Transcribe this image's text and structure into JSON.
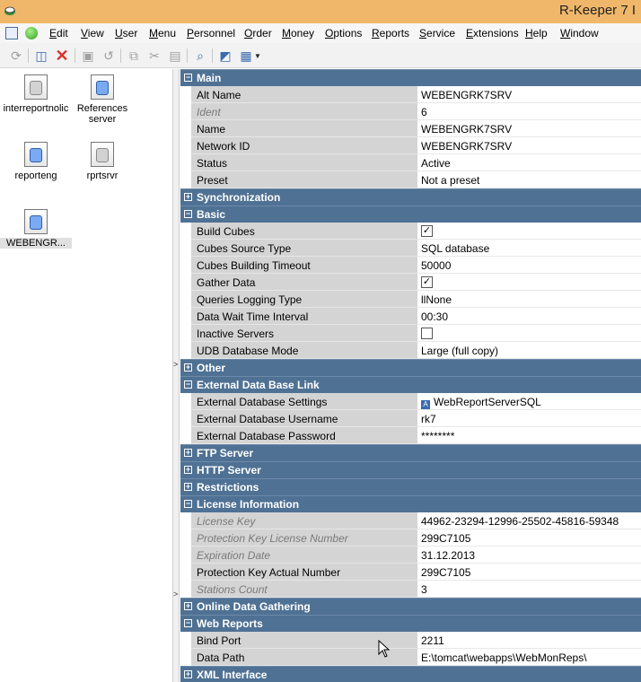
{
  "window": {
    "title": "R-Keeper 7 I"
  },
  "menu": [
    "Edit",
    "View",
    "User",
    "Menu",
    "Personnel",
    "Order",
    "Money",
    "Options",
    "Reports",
    "Service",
    "Extensions",
    "Help",
    "Window"
  ],
  "toolbar_icons": [
    "refresh-icon",
    "select-icon",
    "delete-icon",
    "save-icon",
    "undo-icon",
    "copy-icon",
    "cut-icon",
    "paste-icon",
    "find-icon",
    "properties-icon",
    "grid-view-icon"
  ],
  "servers": [
    {
      "label": "interreportnolic",
      "blue": false
    },
    {
      "label": "References\nserver",
      "blue": true
    },
    {
      "label": "reporteng",
      "blue": true
    },
    {
      "label": "rprtsrvr",
      "blue": false
    },
    {
      "label": "WEBENGR...",
      "blue": true
    }
  ],
  "grid": [
    {
      "type": "section",
      "title": "Main",
      "expanded": true
    },
    {
      "type": "prop",
      "name": "Alt Name",
      "value": "WEBENGRK7SRV"
    },
    {
      "type": "prop",
      "name": "Ident",
      "value": "6",
      "readonly": true
    },
    {
      "type": "prop",
      "name": "Name",
      "value": "WEBENGRK7SRV"
    },
    {
      "type": "prop",
      "name": "Network ID",
      "value": "WEBENGRK7SRV"
    },
    {
      "type": "prop",
      "name": "Status",
      "value": "Active"
    },
    {
      "type": "prop",
      "name": "Preset",
      "value": "Not a preset"
    },
    {
      "type": "section",
      "title": "Synchronization",
      "expanded": false
    },
    {
      "type": "section",
      "title": "Basic",
      "expanded": true
    },
    {
      "type": "prop",
      "name": "Build Cubes",
      "checkbox": true,
      "checked": true
    },
    {
      "type": "prop",
      "name": "Cubes Source Type",
      "value": "SQL database"
    },
    {
      "type": "prop",
      "name": "Cubes Building Timeout",
      "value": "50000"
    },
    {
      "type": "prop",
      "name": "Gather Data",
      "checkbox": true,
      "checked": true
    },
    {
      "type": "prop",
      "name": "Queries Logging Type",
      "value": "llNone"
    },
    {
      "type": "prop",
      "name": "Data Wait Time Interval",
      "value": "00:30"
    },
    {
      "type": "prop",
      "name": "Inactive Servers",
      "checkbox": true,
      "checked": false
    },
    {
      "type": "prop",
      "name": "UDB Database Mode",
      "value": "Large (full copy)"
    },
    {
      "type": "section",
      "title": "Other",
      "expanded": false
    },
    {
      "type": "section",
      "title": "External Data Base Link",
      "expanded": true
    },
    {
      "type": "prop",
      "name": "External Database Settings",
      "value": "WebReportServerSQL",
      "icon": true
    },
    {
      "type": "prop",
      "name": "External Database Username",
      "value": "rk7"
    },
    {
      "type": "prop",
      "name": "External Database Password",
      "value": "********"
    },
    {
      "type": "section",
      "title": "FTP Server",
      "expanded": false
    },
    {
      "type": "section",
      "title": "HTTP Server",
      "expanded": false
    },
    {
      "type": "section",
      "title": "Restrictions",
      "expanded": false
    },
    {
      "type": "section",
      "title": "License Information",
      "expanded": true
    },
    {
      "type": "prop",
      "name": "License Key",
      "value": "44962-23294-12996-25502-45816-59348",
      "readonly": true
    },
    {
      "type": "prop",
      "name": "Protection Key License Number",
      "value": "299C7105",
      "readonly": true
    },
    {
      "type": "prop",
      "name": "Expiration Date",
      "value": "31.12.2013",
      "readonly": true
    },
    {
      "type": "prop",
      "name": "Protection Key Actual Number",
      "value": "299C7105"
    },
    {
      "type": "prop",
      "name": "Stations Count",
      "value": "3",
      "readonly": true
    },
    {
      "type": "section",
      "title": "Online Data Gathering",
      "expanded": false
    },
    {
      "type": "section",
      "title": "Web Reports",
      "expanded": true
    },
    {
      "type": "prop",
      "name": "Bind Port",
      "value": "2211"
    },
    {
      "type": "prop",
      "name": "Data Path",
      "value": "E:\\tomcat\\webapps\\WebMonReps\\"
    },
    {
      "type": "section",
      "title": "XML Interface",
      "expanded": false
    }
  ]
}
